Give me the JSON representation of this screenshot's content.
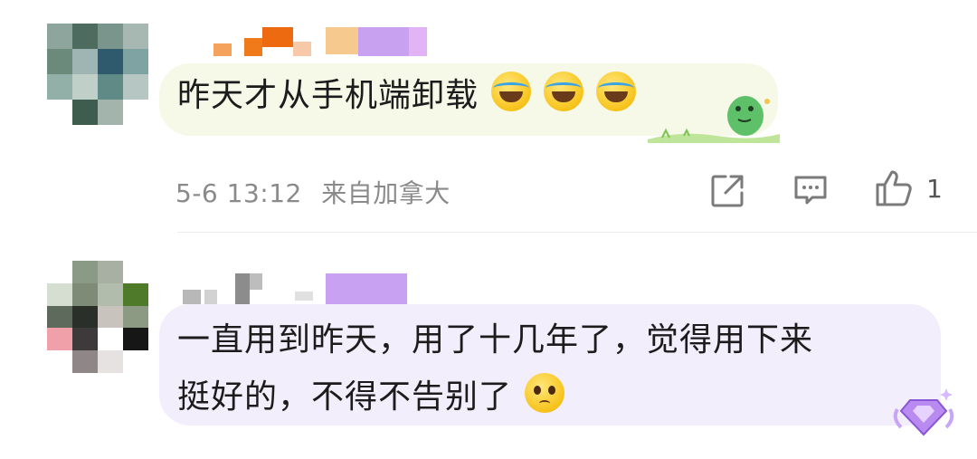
{
  "comments": [
    {
      "text": "昨天才从手机端卸载",
      "timestamp": "5-6 13:12",
      "location": "来自加拿大",
      "emojis": [
        "laugh-cry-emoji",
        "laugh-cry-emoji",
        "laugh-cry-emoji"
      ],
      "like_count": "1",
      "decoration": "dinosaur-sticker"
    },
    {
      "line1": "一直用到昨天，用了十几年了，觉得用下来",
      "line2": "挺好的，不得不告别了",
      "emojis": [
        "pleading-emoji"
      ],
      "decoration": "diamond-badge"
    }
  ],
  "colors": {
    "bubble1": "#f6f8e8",
    "bubble2": "#f3eefb",
    "meta_text": "#8a8a8a",
    "icon": "#7a7a7a"
  }
}
